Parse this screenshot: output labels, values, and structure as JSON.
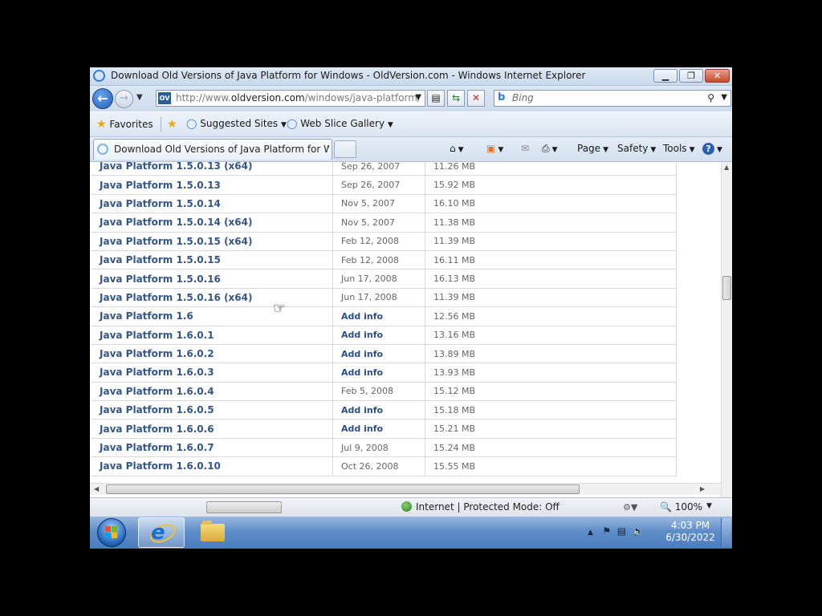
{
  "window": {
    "title": "Download Old Versions of Java Platform for Windows - OldVersion.com - Windows Internet Explorer",
    "caption_min": "▁",
    "caption_max": "❐",
    "caption_close": "✕"
  },
  "address": {
    "favicon": "OV",
    "url_prefix": "http://www.",
    "url_domain": "oldversion.com",
    "url_path": "/windows/java-platform/",
    "search_placeholder": "Bing"
  },
  "favorites_bar": {
    "favorites": "Favorites",
    "suggested_sites": "Suggested Sites",
    "web_slice_gallery": "Web Slice Gallery"
  },
  "tabs": [
    {
      "label": "Download Old Versions of Java Platform for Wind..."
    }
  ],
  "command_bar": {
    "page": "Page",
    "safety": "Safety",
    "tools": "Tools",
    "help": "?"
  },
  "versions": [
    {
      "name": "Java Platform 1.5.0.13 (x64)",
      "date": "Sep 26, 2007",
      "size": "11.26 MB"
    },
    {
      "name": "Java Platform 1.5.0.13",
      "date": "Sep 26, 2007",
      "size": "15.92 MB"
    },
    {
      "name": "Java Platform 1.5.0.14",
      "date": "Nov 5, 2007",
      "size": "16.10 MB"
    },
    {
      "name": "Java Platform 1.5.0.14 (x64)",
      "date": "Nov 5, 2007",
      "size": "11.38 MB"
    },
    {
      "name": "Java Platform 1.5.0.15 (x64)",
      "date": "Feb 12, 2008",
      "size": "11.39 MB"
    },
    {
      "name": "Java Platform 1.5.0.15",
      "date": "Feb 12, 2008",
      "size": "16.11 MB"
    },
    {
      "name": "Java Platform 1.5.0.16",
      "date": "Jun 17, 2008",
      "size": "16.13 MB"
    },
    {
      "name": "Java Platform 1.5.0.16 (x64)",
      "date": "Jun 17, 2008",
      "size": "11.39 MB"
    },
    {
      "name": "Java Platform 1.6",
      "date": "Add info",
      "size": "12.56 MB"
    },
    {
      "name": "Java Platform 1.6.0.1",
      "date": "Add info",
      "size": "13.16 MB"
    },
    {
      "name": "Java Platform 1.6.0.2",
      "date": "Add info",
      "size": "13.89 MB"
    },
    {
      "name": "Java Platform 1.6.0.3",
      "date": "Add info",
      "size": "13.93 MB"
    },
    {
      "name": "Java Platform 1.6.0.4",
      "date": "Feb 5, 2008",
      "size": "15.12 MB"
    },
    {
      "name": "Java Platform 1.6.0.5",
      "date": "Add info",
      "size": "15.18 MB"
    },
    {
      "name": "Java Platform 1.6.0.6",
      "date": "Add info",
      "size": "15.21 MB"
    },
    {
      "name": "Java Platform 1.6.0.7",
      "date": "Jul 9, 2008",
      "size": "15.24 MB"
    },
    {
      "name": "Java Platform 1.6.0.10",
      "date": "Oct 26, 2008",
      "size": "15.55 MB"
    }
  ],
  "statusbar": {
    "zone": "Internet | Protected Mode: Off",
    "zoom": "100%"
  },
  "taskbar": {
    "time": "4:03 PM",
    "date": "6/30/2022"
  },
  "colors": {
    "link": "#33568a",
    "taskbar": "#5f8ec9"
  }
}
